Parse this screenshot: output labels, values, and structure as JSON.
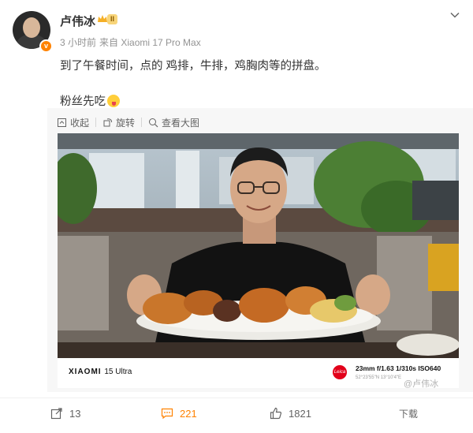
{
  "user": {
    "name": "卢伟冰",
    "level_badge": "II",
    "verified_mark": "v"
  },
  "meta": {
    "time": "3 小时前",
    "source": "来自 Xiaomi 17 Pro Max"
  },
  "post": {
    "line1": "到了午餐时间，点的 鸡排，牛排，鸡胸肉等的拼盘。",
    "line2": "粉丝先吃"
  },
  "media_tools": {
    "collect": "收起",
    "rotate": "旋转",
    "view_large": "查看大图"
  },
  "photo_exif": {
    "brand": "XIAOMI",
    "model": "15 Ultra",
    "leica": "Leica",
    "params": "23mm  f/1.63  1/310s  ISO640",
    "gps": "52°23'55\"N    13°10'4\"E"
  },
  "watermark": "@卢伟冰",
  "actions": {
    "repost_count": "13",
    "comment_count": "221",
    "like_count": "1821",
    "more_label": "下载"
  },
  "colors": {
    "accent": "#ff8200",
    "meta_gray": "#939393"
  },
  "icons": [
    "crown-icon",
    "chevron-down-icon",
    "collapse-icon",
    "rotate-icon",
    "zoom-icon",
    "repost-icon",
    "comment-icon",
    "like-icon"
  ]
}
